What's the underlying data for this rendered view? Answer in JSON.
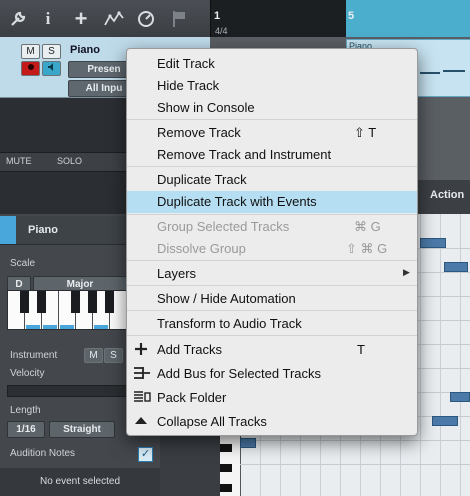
{
  "toolbar": {
    "icons": [
      "wrench-icon",
      "info-icon",
      "add-icon",
      "automation-icon",
      "tempo-icon",
      "marker-flag-icon"
    ],
    "info_glyph": "i",
    "add_glyph": "+"
  },
  "ruler": {
    "bar_1": "1",
    "bar_5": "5",
    "signature": "4/4"
  },
  "track": {
    "name": "Piano",
    "mute": "M",
    "solo": "S",
    "preset": "Presen",
    "input": "All Inpu"
  },
  "event": {
    "label": "Piano"
  },
  "mute_solo_strip": {
    "mute": "MUTE",
    "solo": "SOLO"
  },
  "inspector": {
    "title": "Piano",
    "scale_label": "Scale",
    "scale_root": "D",
    "scale_mode": "Major",
    "instrument_label": "Instrument",
    "instrument_m": "M",
    "instrument_s": "S",
    "velocity_label": "Velocity",
    "length_label": "Length",
    "length_value": "1/16",
    "length_mode": "Straight",
    "audition_label": "Audition Notes",
    "audition_checked": "✓",
    "no_event": "No event selected"
  },
  "editor": {
    "action_label": "Action"
  },
  "context_menu": {
    "items": [
      {
        "label": "Edit Track",
        "shortcut": "",
        "disabled": false
      },
      {
        "label": "Hide Track",
        "shortcut": "",
        "disabled": false
      },
      {
        "label": "Show in Console",
        "shortcut": "",
        "disabled": false
      },
      {
        "label": "Remove Track",
        "shortcut": "⇧ T",
        "disabled": false
      },
      {
        "label": "Remove Track and Instrument",
        "shortcut": "",
        "disabled": false
      },
      {
        "label": "Duplicate Track",
        "shortcut": "",
        "disabled": false
      },
      {
        "label": "Duplicate Track with Events",
        "shortcut": "",
        "disabled": false,
        "highlighted": true
      },
      {
        "label": "Group Selected Tracks",
        "shortcut": "⌘ G",
        "disabled": true
      },
      {
        "label": "Dissolve Group",
        "shortcut": "⇧ ⌘ G",
        "disabled": true
      },
      {
        "label": "Layers",
        "shortcut": "",
        "disabled": false,
        "submenu": true
      },
      {
        "label": "Show / Hide Automation",
        "shortcut": "",
        "disabled": false
      },
      {
        "label": "Transform to Audio Track",
        "shortcut": "",
        "disabled": false
      },
      {
        "label": "Add Tracks",
        "shortcut": "T",
        "disabled": false,
        "icon": "plus-icon"
      },
      {
        "label": "Add Bus for Selected Tracks",
        "shortcut": "",
        "disabled": false,
        "icon": "bus-icon"
      },
      {
        "label": "Pack Folder",
        "shortcut": "",
        "disabled": false,
        "icon": "folder-pack-icon"
      },
      {
        "label": "Collapse All Tracks",
        "shortcut": "",
        "disabled": false,
        "icon": "collapse-icon"
      }
    ]
  }
}
